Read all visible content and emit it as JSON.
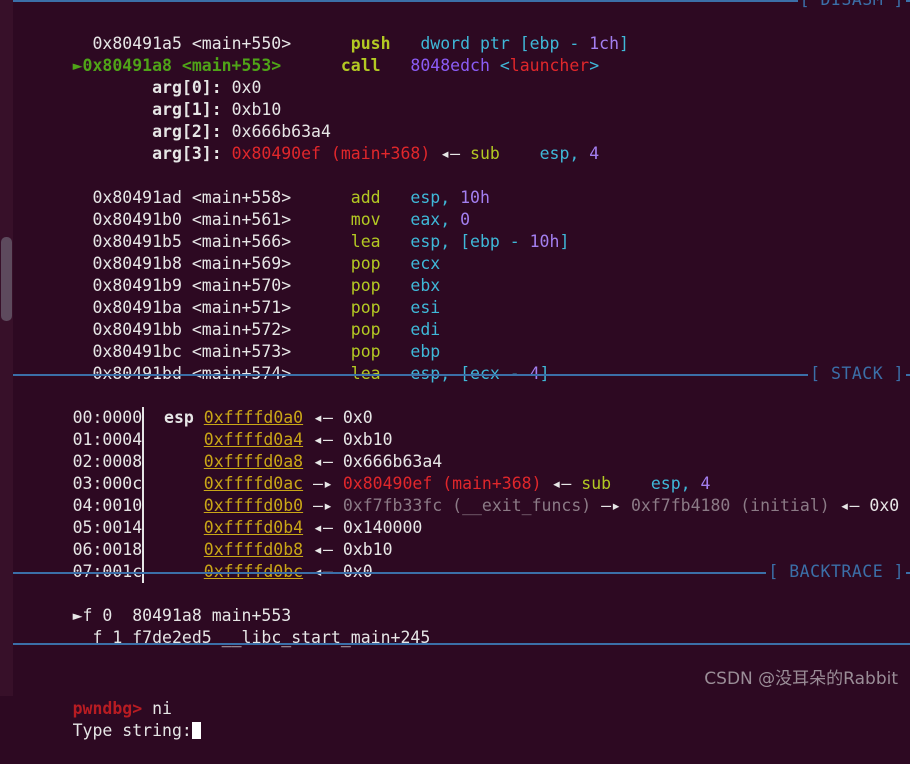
{
  "terminal": {
    "title": "pwndbg",
    "background_color": "#2d0922",
    "scrollbar": {
      "name": "vertical-scrollbar"
    }
  },
  "sections": {
    "disasm_label": "[ DISASM ]",
    "stack_label": "[ STACK ]",
    "backtrace_label": "[ BACKTRACE ]"
  },
  "disasm": {
    "lines": [
      {
        "marker": "",
        "addr": "0x80491a5",
        "sym": "<main+550>",
        "mnemonic": "push",
        "ops_pre": "dword ptr [ebp - ",
        "ops_num": "1ch",
        "ops_post": "]",
        "current": false
      },
      {
        "marker": "►",
        "addr": "0x80491a8",
        "sym": "<main+553>",
        "mnemonic": "call",
        "target_addr": "8048edch",
        "target_sym": "<launcher>",
        "current": true
      }
    ],
    "args": [
      {
        "label": "arg[0]:",
        "value": "0x0"
      },
      {
        "label": "arg[1]:",
        "value": "0xb10"
      },
      {
        "label": "arg[2]:",
        "value": "0x666b63a4"
      },
      {
        "label": "arg[3]:",
        "value": "0x80490ef (main+368)",
        "arrow": "◂—",
        "deref_mnemonic": "sub",
        "deref_ops_reg": "esp,",
        "deref_ops_num": "4"
      }
    ],
    "after": [
      {
        "addr": "0x80491ad",
        "sym": "<main+558>",
        "mnemonic": "add",
        "op_reg": "esp,",
        "op_num": "10h"
      },
      {
        "addr": "0x80491b0",
        "sym": "<main+561>",
        "mnemonic": "mov",
        "op_reg": "eax,",
        "op_num": "0"
      },
      {
        "addr": "0x80491b5",
        "sym": "<main+566>",
        "mnemonic": "lea",
        "op_reg": "esp, [ebp - ",
        "op_num": "10h",
        "op_tail": "]"
      },
      {
        "addr": "0x80491b8",
        "sym": "<main+569>",
        "mnemonic": "pop",
        "op_reg": "ecx",
        "op_num": ""
      },
      {
        "addr": "0x80491b9",
        "sym": "<main+570>",
        "mnemonic": "pop",
        "op_reg": "ebx",
        "op_num": ""
      },
      {
        "addr": "0x80491ba",
        "sym": "<main+571>",
        "mnemonic": "pop",
        "op_reg": "esi",
        "op_num": ""
      },
      {
        "addr": "0x80491bb",
        "sym": "<main+572>",
        "mnemonic": "pop",
        "op_reg": "edi",
        "op_num": ""
      },
      {
        "addr": "0x80491bc",
        "sym": "<main+573>",
        "mnemonic": "pop",
        "op_reg": "ebp",
        "op_num": ""
      },
      {
        "addr": "0x80491bd",
        "sym": "<main+574>",
        "mnemonic": "lea",
        "op_reg": "esp, [ecx - ",
        "op_num": "4",
        "op_tail": "]"
      }
    ]
  },
  "stack": {
    "rows": [
      {
        "index": "00:0000",
        "reg": "esp",
        "addr": "0xffffd0a0",
        "arrow": "◂—",
        "value": "0x0"
      },
      {
        "index": "01:0004",
        "reg": "",
        "addr": "0xffffd0a4",
        "arrow": "◂—",
        "value": "0xb10"
      },
      {
        "index": "02:0008",
        "reg": "",
        "addr": "0xffffd0a8",
        "arrow": "◂—",
        "value": "0x666b63a4"
      },
      {
        "index": "03:000c",
        "reg": "",
        "addr": "0xffffd0ac",
        "arrow": "—▸",
        "value": "0x80490ef (main+368)",
        "arrow2": "◂—",
        "mnemonic": "sub",
        "ops_reg": "esp,",
        "ops_num": "4"
      },
      {
        "index": "04:0010",
        "reg": "",
        "addr": "0xffffd0b0",
        "arrow": "—▸",
        "value": "0xf7fb33fc (__exit_funcs)",
        "arrow2": "—▸",
        "value2": "0xf7fb4180 (initial)",
        "arrow3": "◂—",
        "value3": "0x0"
      },
      {
        "index": "05:0014",
        "reg": "",
        "addr": "0xffffd0b4",
        "arrow": "◂—",
        "value": "0x140000"
      },
      {
        "index": "06:0018",
        "reg": "",
        "addr": "0xffffd0b8",
        "arrow": "◂—",
        "value": "0xb10"
      },
      {
        "index": "07:001c",
        "reg": "",
        "addr": "0xffffd0bc",
        "arrow": "◂—",
        "value": "0x0"
      }
    ]
  },
  "backtrace": {
    "frames": [
      {
        "marker": "►",
        "frame": "f 0",
        "addr": "80491a8",
        "sym": "main+553"
      },
      {
        "marker": "",
        "frame": "f 1",
        "addr": "f7de2ed5",
        "sym": "__libc_start_main+245"
      }
    ]
  },
  "prompt": {
    "prompt_text": "pwndbg>",
    "command": "ni",
    "output_line": "Type string:"
  },
  "watermark": {
    "text": "CSDN @没耳朵的Rabbit"
  }
}
